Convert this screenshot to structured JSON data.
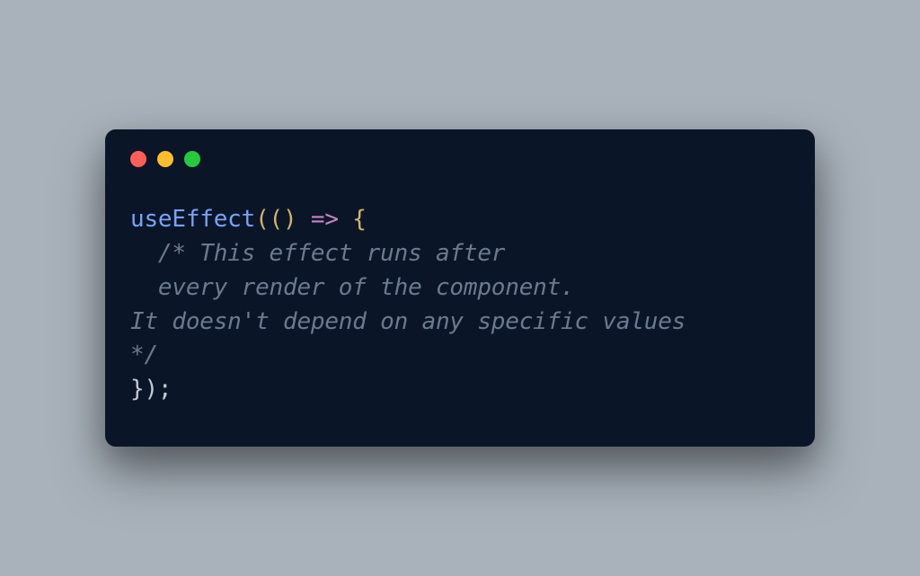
{
  "code": {
    "fn_name": "useEffect",
    "paren_open": "(()",
    "arrow": " => ",
    "brace_open": "{",
    "comment_l1": "  /* This effect runs after",
    "comment_l2": "  every render of the component.",
    "comment_l3": "It doesn't depend on any specific values",
    "comment_l4": "*/",
    "closing": "});"
  }
}
